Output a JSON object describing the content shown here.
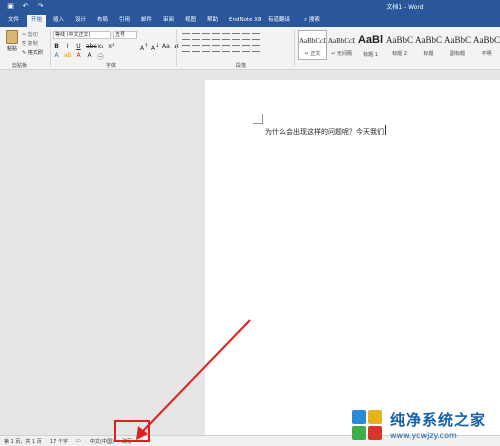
{
  "window": {
    "title": "文档1 - Word",
    "titlebar_color": "#2b579a"
  },
  "quick_access": {
    "save_icon": "save-icon",
    "undo_icon": "undo-icon",
    "redo_icon": "redo-icon"
  },
  "tabs": [
    {
      "label": "文件"
    },
    {
      "label": "开始"
    },
    {
      "label": "插入"
    },
    {
      "label": "设计"
    },
    {
      "label": "布局"
    },
    {
      "label": "引用"
    },
    {
      "label": "邮件"
    },
    {
      "label": "审阅"
    },
    {
      "label": "视图"
    },
    {
      "label": "帮助"
    },
    {
      "label": "EndNote X8"
    },
    {
      "label": "有道翻译"
    },
    {
      "label": "搜索"
    }
  ],
  "active_tab": "开始",
  "clipboard": {
    "paste_label": "粘贴",
    "cut_label": "剪切",
    "copy_label": "复制",
    "format_painter_label": "格式刷",
    "group_label": "剪贴板"
  },
  "font": {
    "font_name": "等线 (中文正文)",
    "font_size": "五号",
    "group_label": "字体"
  },
  "paragraph": {
    "group_label": "段落"
  },
  "styles": [
    {
      "sample": "AaBbCcDc",
      "name": "↵ 正文"
    },
    {
      "sample": "AaBbCcDc",
      "name": "↵ 无间隔"
    },
    {
      "sample": "AaBl",
      "name": "标题 1"
    },
    {
      "sample": "AaBbC",
      "name": "标题 2"
    },
    {
      "sample": "AaBbC",
      "name": "标题"
    },
    {
      "sample": "AaBbC",
      "name": "副标题"
    },
    {
      "sample": "AaBbC",
      "name": "不明"
    }
  ],
  "document": {
    "text": "为什么会出现这样的问题呢？今天我们"
  },
  "statusbar": {
    "page": "第 1 页，共 1 页",
    "words": "17 个字",
    "language": "中文(中国)",
    "mode": "改写"
  },
  "watermark": {
    "title": "纯净系统之家",
    "url": "www.ycwjzy.com"
  },
  "colors": {
    "accent": "#2b579a",
    "highlight": "#e02020"
  }
}
